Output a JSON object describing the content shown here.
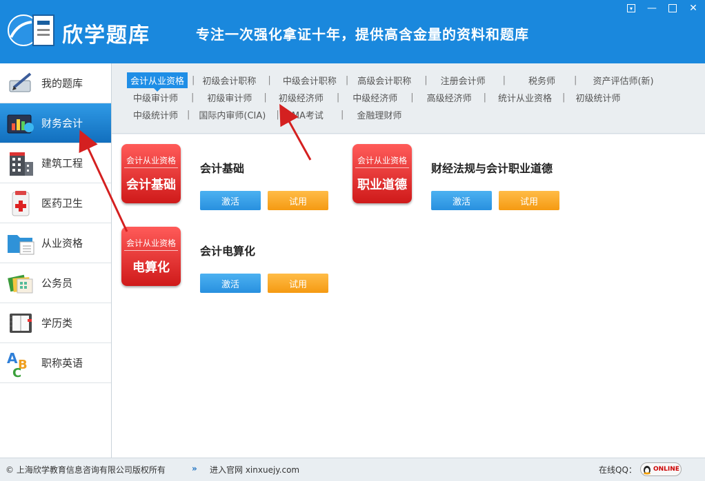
{
  "header": {
    "logo_text": "欣学题库",
    "tagline": "专注一次强化拿证十年，提供高含金量的资料和题库",
    "window_controls": [
      "dropdown-icon",
      "minimize-icon",
      "maximize-icon",
      "close-icon"
    ]
  },
  "sidebar": {
    "items": [
      {
        "label": "我的题库",
        "icon": "pen-notebook-icon",
        "active": false
      },
      {
        "label": "财务会计",
        "icon": "chart-icon",
        "active": true
      },
      {
        "label": "建筑工程",
        "icon": "building-icon",
        "active": false
      },
      {
        "label": "医药卫生",
        "icon": "medical-icon",
        "active": false
      },
      {
        "label": "从业资格",
        "icon": "folder-icon",
        "active": false
      },
      {
        "label": "公务员",
        "icon": "files-icon",
        "active": false
      },
      {
        "label": "学历类",
        "icon": "book-icon",
        "active": false
      },
      {
        "label": "职称英语",
        "icon": "abc-icon",
        "active": false
      }
    ]
  },
  "categories": {
    "row1": [
      "会计从业资格",
      "初级会计职称",
      "中级会计职称",
      "高级会计职称",
      "注册会计师",
      "税务师",
      "资产评估师(新)"
    ],
    "row2": [
      "中级审计师",
      "初级审计师",
      "初级经济师",
      "中级经济师",
      "高级经济师",
      "统计从业资格",
      "初级统计师"
    ],
    "row3": [
      "中级统计师",
      "国际内审师(CIA)",
      "CMA考试",
      "金融理财师"
    ],
    "selected": "会计从业资格"
  },
  "products": [
    {
      "badge_top": "会计从业资格",
      "badge_main": "会计基础",
      "name": "会计基础",
      "activate": "激活",
      "trial": "试用"
    },
    {
      "badge_top": "会计从业资格",
      "badge_main": "职业道德",
      "name": "财经法规与会计职业道德",
      "activate": "激活",
      "trial": "试用"
    },
    {
      "badge_top": "会计从业资格",
      "badge_main": "电算化",
      "name": "会计电算化",
      "activate": "激活",
      "trial": "试用"
    }
  ],
  "footer": {
    "copyright": "© 上海欣学教育信息咨询有限公司版权所有",
    "chevron": "»",
    "site_label": "进入官网 xinxuejy.com",
    "qq_label": "在线QQ：",
    "qq_button": "ONLINE"
  },
  "colors": {
    "header_bg": "#1a88dd",
    "active_tab": "#1f8ee6",
    "badge_red": "#d92222",
    "activate_blue": "#2d93e2",
    "trial_orange": "#f7a21c"
  }
}
